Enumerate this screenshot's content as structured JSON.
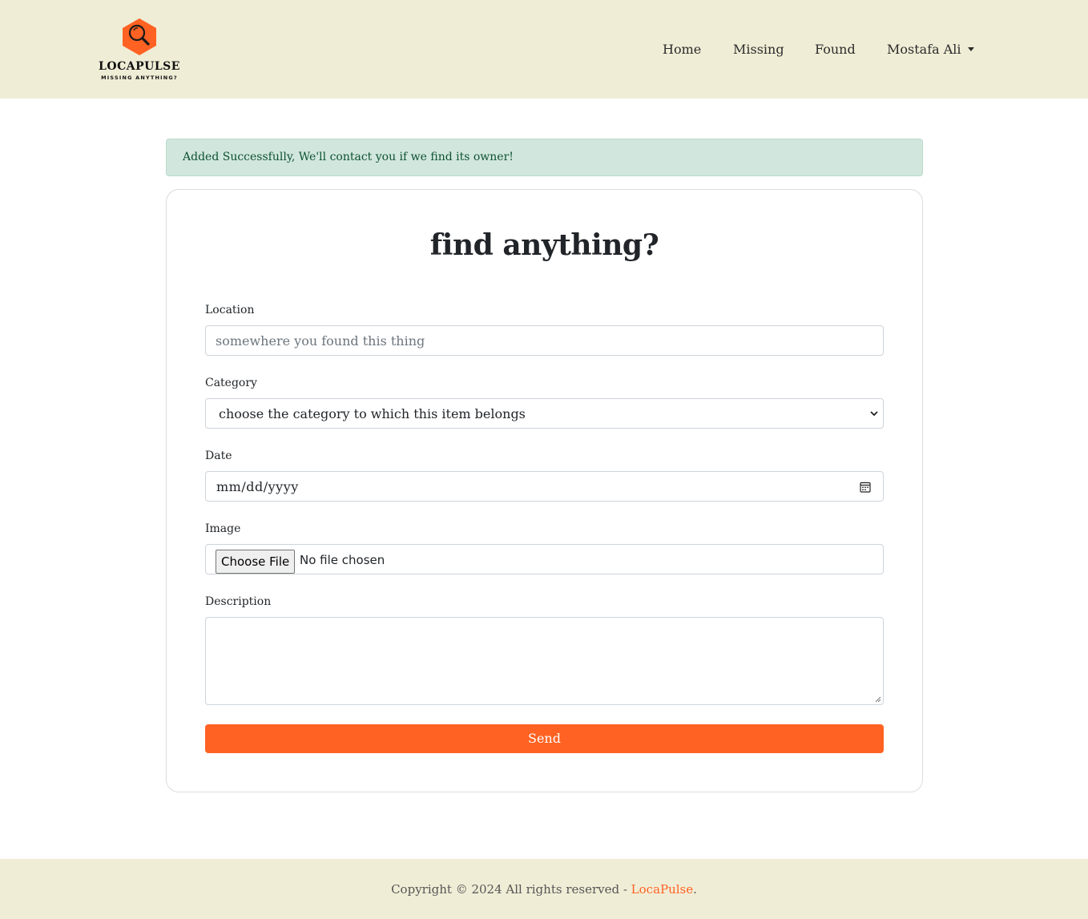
{
  "brand": {
    "name": "LOCAPULSE",
    "tagline": "MISSING ANYTHING?",
    "logo_icon": "magnifier-hexagon-icon",
    "accent_color": "#ff6223"
  },
  "nav": {
    "home": "Home",
    "missing": "Missing",
    "found": "Found",
    "user": "Mostafa Ali"
  },
  "alert": {
    "message": "Added Successfully, We'll contact you if we find its owner!"
  },
  "form": {
    "title": "find anything?",
    "location": {
      "label": "Location",
      "placeholder": "somewhere you found this thing"
    },
    "category": {
      "label": "Category",
      "selected": "choose the category to which this item belongs"
    },
    "date": {
      "label": "Date",
      "value": "mm/dd/yyyy"
    },
    "image": {
      "label": "Image",
      "button": "Choose File",
      "status": "No file chosen"
    },
    "description": {
      "label": "Description"
    },
    "submit": "Send"
  },
  "footer": {
    "text": "Copyright © 2024 All rights reserved - ",
    "brand": "LocaPulse",
    "end": "."
  }
}
